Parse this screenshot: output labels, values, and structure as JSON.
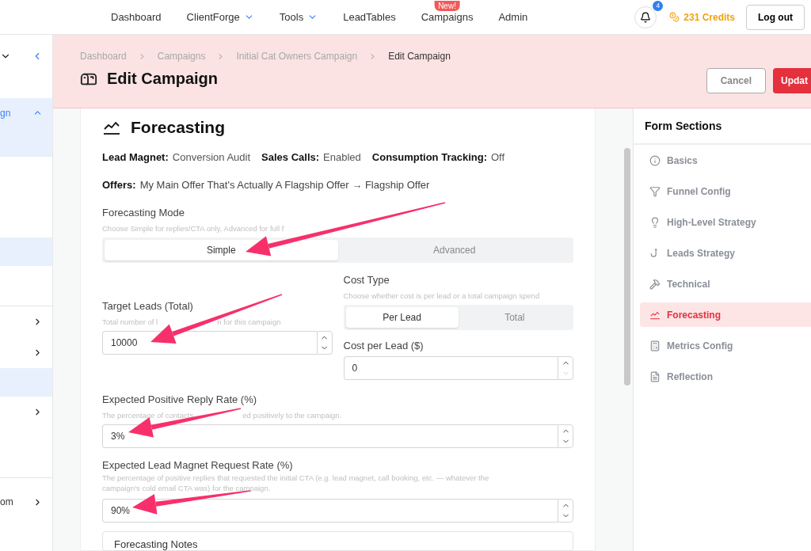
{
  "top_nav": {
    "items": [
      {
        "label": "Dashboard",
        "dropdown": false
      },
      {
        "label": "ClientForge",
        "dropdown": true
      },
      {
        "label": "Tools",
        "dropdown": true
      },
      {
        "label": "LeadTables",
        "dropdown": false
      },
      {
        "label": "Campaigns",
        "dropdown": false,
        "badge": "New!"
      },
      {
        "label": "Admin",
        "dropdown": false
      }
    ],
    "notification_count": "4",
    "credits": "231 Credits",
    "logout": "Log out"
  },
  "sidebar": {
    "items": [
      {
        "kind": "header"
      },
      {
        "kind": "item",
        "label": "gn",
        "selected": true,
        "expanded": true
      },
      {
        "kind": "blank",
        "selected": false
      },
      {
        "kind": "blank",
        "selected": true
      },
      {
        "kind": "divider"
      },
      {
        "kind": "arrow",
        "selected": false
      },
      {
        "kind": "arrow",
        "selected": false
      },
      {
        "kind": "blank",
        "selected": true
      },
      {
        "kind": "arrow",
        "selected": false
      },
      {
        "kind": "divider"
      },
      {
        "kind": "item",
        "label": "om",
        "selected": false,
        "expanded": false
      }
    ]
  },
  "header": {
    "breadcrumb": [
      "Dashboard",
      "Campaigns",
      "Initial Cat Owners Campaign",
      "Edit Campaign"
    ],
    "title": "Edit Campaign",
    "cancel": "Cancel",
    "update": "Updat"
  },
  "form": {
    "title": "Forecasting",
    "summary": [
      {
        "label": "Lead Magnet:",
        "value": "Conversion Audit"
      },
      {
        "label": "Sales Calls:",
        "value": "Enabled"
      },
      {
        "label": "Consumption Tracking:",
        "value": "Off"
      }
    ],
    "offers": {
      "label": "Offers:",
      "value": "My Main Offer That's Actually A Flagship Offer → Flagship Offer"
    },
    "mode": {
      "label": "Forecasting Mode",
      "hint": "Choose Simple for replies/CTA only, Advanced for full f",
      "options": [
        {
          "label": "Simple",
          "selected": true
        },
        {
          "label": "Advanced",
          "selected": false
        }
      ]
    },
    "target_leads": {
      "label": "Target Leads (Total)",
      "hint_parts": [
        "Total number of l",
        "n for this campaign"
      ],
      "value": "10000"
    },
    "cost_type": {
      "label": "Cost Type",
      "hint": "Choose whether cost is per lead or a total campaign spend",
      "options": [
        {
          "label": "Per Lead",
          "selected": true
        },
        {
          "label": "Total",
          "selected": false
        }
      ]
    },
    "cost_per_lead": {
      "label": "Cost per Lead ($)",
      "value": "0",
      "down_disabled": true
    },
    "reply_rate": {
      "label": "Expected Positive Reply Rate (%)",
      "hint_parts": [
        "The percentage of contacts",
        "ed positively to the campaign."
      ],
      "value": "3%"
    },
    "magnet_rate": {
      "label": "Expected Lead Magnet Request Rate (%)",
      "hint": "The percentage of positive replies that requested the initial CTA (e.g. lead magnet, call booking, etc. — whatever the campaign's cold email CTA was) for the campaign.",
      "value": "90%"
    },
    "notes": {
      "label": "Forecasting Notes"
    }
  },
  "form_sections": {
    "title": "Form Sections",
    "items": [
      {
        "label": "Basics",
        "selected": false
      },
      {
        "label": "Funnel Config",
        "selected": false
      },
      {
        "label": "High-Level Strategy",
        "selected": false
      },
      {
        "label": "Leads Strategy",
        "selected": false
      },
      {
        "label": "Technical",
        "selected": false
      },
      {
        "label": "Forecasting",
        "selected": true
      },
      {
        "label": "Metrics Config",
        "selected": false
      },
      {
        "label": "Reflection",
        "selected": false
      }
    ]
  }
}
